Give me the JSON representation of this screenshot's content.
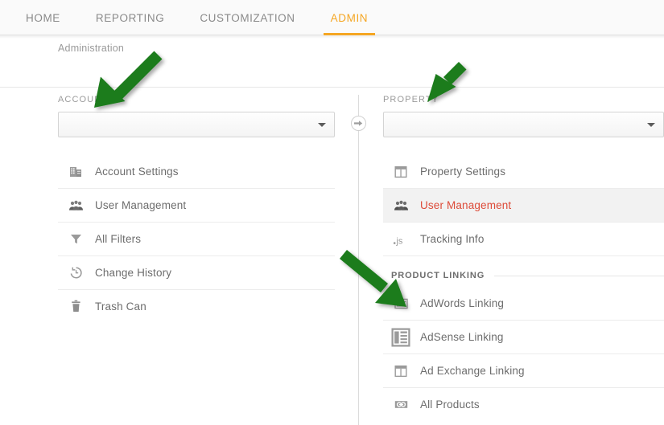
{
  "topnav": {
    "tabs": [
      {
        "label": "HOME",
        "active": false
      },
      {
        "label": "REPORTING",
        "active": false
      },
      {
        "label": "CUSTOMIZATION",
        "active": false
      },
      {
        "label": "ADMIN",
        "active": true
      }
    ],
    "accent_color": "#f5a623",
    "inactive_color": "#8a8a8a",
    "background": "#fafafa"
  },
  "breadcrumb": {
    "label": "Administration"
  },
  "account": {
    "column_label": "ACCOUNT",
    "select": {
      "value": "",
      "placeholder": ""
    },
    "menu": [
      {
        "label": "Account Settings",
        "icon": "building-icon"
      },
      {
        "label": "User Management",
        "icon": "users-icon"
      },
      {
        "label": "All Filters",
        "icon": "filter-icon"
      },
      {
        "label": "Change History",
        "icon": "history-clock-icon"
      },
      {
        "label": "Trash Can",
        "icon": "trash-icon"
      }
    ]
  },
  "property": {
    "column_label": "PROPERTY",
    "select": {
      "value": "",
      "placeholder": ""
    },
    "menu": [
      {
        "label": "Property Settings",
        "icon": "layout-panel-icon",
        "selected": false
      },
      {
        "label": "User Management",
        "icon": "users-icon",
        "selected": true
      },
      {
        "label": "Tracking Info",
        "icon": "js-code-icon",
        "selected": false
      }
    ],
    "group": {
      "title": "PRODUCT LINKING",
      "items": [
        {
          "label": "AdWords Linking",
          "icon": "adwords-card-icon"
        },
        {
          "label": "AdSense Linking",
          "icon": "adsense-columns-icon"
        },
        {
          "label": "Ad Exchange Linking",
          "icon": "layout-panel-icon"
        },
        {
          "label": "All Products",
          "icon": "link-chain-icon"
        }
      ]
    },
    "selected_color": "#dd4b39",
    "selected_background": "#f2f2f2"
  },
  "connector": {
    "icon": "circled-arrow-right-icon"
  },
  "annotations": {
    "color": "#1b7b1b",
    "arrows": [
      {
        "name": "arrow-to-account",
        "points_to": "ACCOUNT"
      },
      {
        "name": "arrow-to-property",
        "points_to": "PROPERTY"
      },
      {
        "name": "arrow-to-adwords-linking",
        "points_to": "AdWords Linking"
      }
    ]
  }
}
